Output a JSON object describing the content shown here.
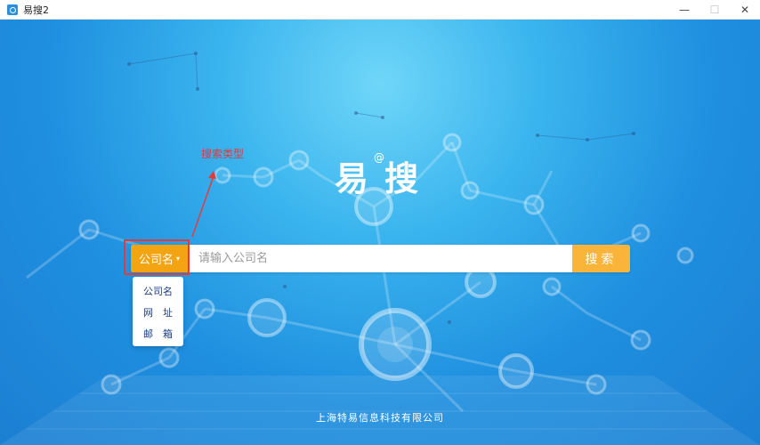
{
  "window": {
    "title": "易搜2",
    "minimize_glyph": "—",
    "maximize_glyph": "☐",
    "close_glyph": "✕"
  },
  "logo": {
    "char1": "易",
    "at": "@",
    "char2": "搜"
  },
  "annotation": {
    "label": "搜索类型",
    "color": "#e03a3a"
  },
  "search": {
    "type_selected": "公司名",
    "caret": "▾",
    "placeholder": "请输入公司名",
    "value": "",
    "button_label": "搜索"
  },
  "dropdown": {
    "options": [
      "公司名",
      "网　址",
      "邮　箱"
    ]
  },
  "footer": {
    "company": "上海特易信息科技有限公司"
  },
  "colors": {
    "accent_orange": "#f3a413",
    "button_orange": "#fab43a",
    "background_blue": "#2aa3ea"
  }
}
